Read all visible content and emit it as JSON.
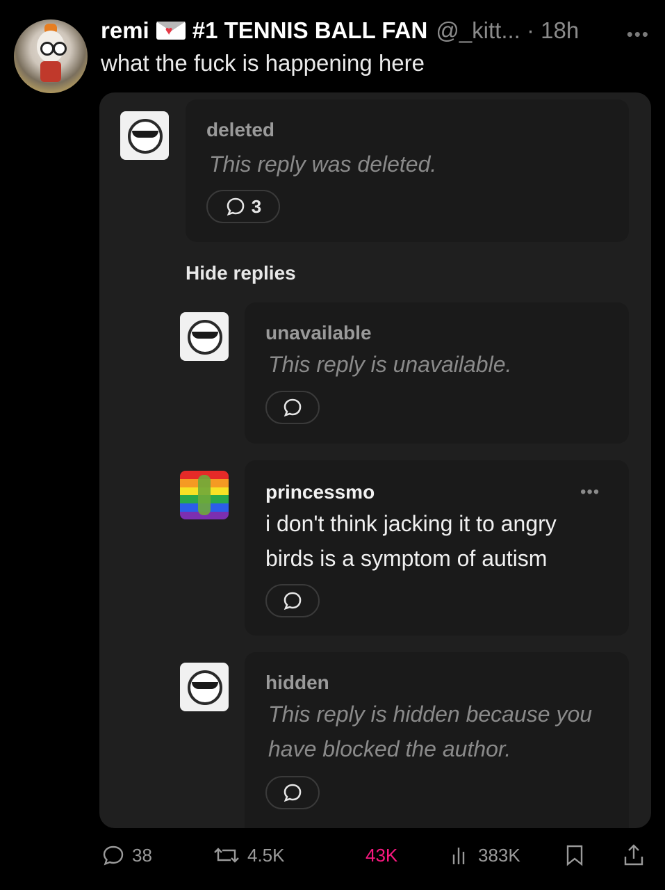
{
  "post": {
    "author_name": "remi",
    "badge_icon": "love-letter-icon",
    "tagline": "#1 TENNIS BALL FAN",
    "handle_time": "@_kitt... · 18h",
    "more": "•••",
    "text": "what the fuck is happening here"
  },
  "thread": {
    "first_reply": {
      "username": "deleted",
      "message": "This reply was deleted.",
      "reply_count": "3"
    },
    "hide_replies_label": "Hide replies",
    "replies": [
      {
        "username": "unavailable",
        "message": "This reply is unavailable."
      },
      {
        "username": "princessmo",
        "message": "i don't think jacking it to angry birds is a symptom of autism",
        "more": "•••"
      },
      {
        "username": "hidden",
        "message": "This reply is hidden because you have blocked the author."
      }
    ]
  },
  "actions": {
    "replies": "38",
    "reposts": "4.5K",
    "likes": "43K",
    "views": "383K",
    "like_color": "#f91880"
  }
}
